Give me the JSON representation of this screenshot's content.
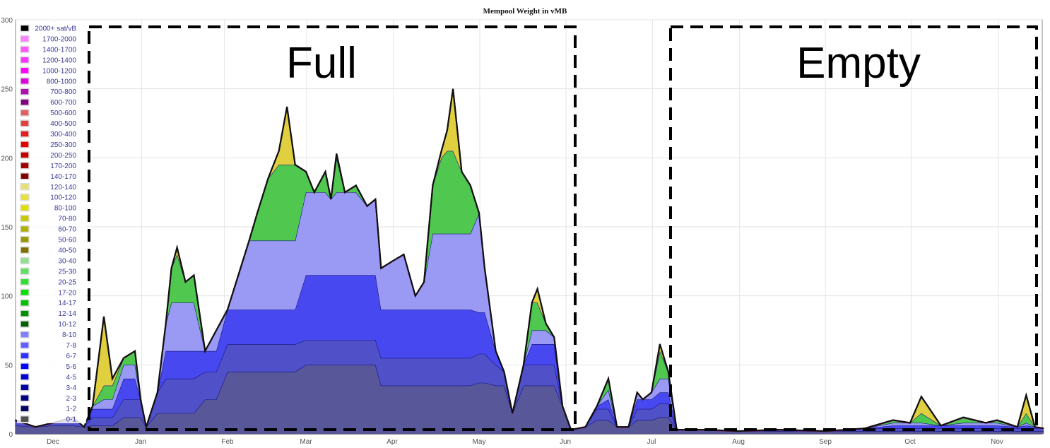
{
  "chart_data": {
    "type": "area",
    "stacked": true,
    "title": "Mempool Weight in vMB",
    "xlabel": "",
    "ylabel": "",
    "ylim": [
      0,
      300
    ],
    "yticks": [
      0,
      50,
      100,
      150,
      200,
      250,
      300
    ],
    "xticks": [
      "Dec",
      "Jan",
      "Feb",
      "Mar",
      "Apr",
      "May",
      "Jun",
      "Jul",
      "Aug",
      "Sep",
      "Oct",
      "Nov"
    ],
    "grid": true,
    "legend_position": "top-left",
    "legend": [
      {
        "label": "2000+ sat/vB",
        "color": "#000000"
      },
      {
        "label": "1700-2000",
        "color": "#ff80ff"
      },
      {
        "label": "1400-1700",
        "color": "#ff55ff"
      },
      {
        "label": "1200-1400",
        "color": "#ff33ff"
      },
      {
        "label": "1000-1200",
        "color": "#ff00ff"
      },
      {
        "label": "800-1000",
        "color": "#dd00dd"
      },
      {
        "label": "700-800",
        "color": "#aa10aa"
      },
      {
        "label": "600-700",
        "color": "#800080"
      },
      {
        "label": "500-600",
        "color": "#e06060"
      },
      {
        "label": "400-500",
        "color": "#e04040"
      },
      {
        "label": "300-400",
        "color": "#e02020"
      },
      {
        "label": "250-300",
        "color": "#e00000"
      },
      {
        "label": "200-250",
        "color": "#c00000"
      },
      {
        "label": "170-200",
        "color": "#a00000"
      },
      {
        "label": "140-170",
        "color": "#800000"
      },
      {
        "label": "120-140",
        "color": "#e8e070"
      },
      {
        "label": "100-120",
        "color": "#e8e040"
      },
      {
        "label": "80-100",
        "color": "#e0e000"
      },
      {
        "label": "70-80",
        "color": "#c8c800"
      },
      {
        "label": "60-70",
        "color": "#b0b000"
      },
      {
        "label": "50-60",
        "color": "#989800"
      },
      {
        "label": "40-50",
        "color": "#807000"
      },
      {
        "label": "30-40",
        "color": "#90e090"
      },
      {
        "label": "25-30",
        "color": "#60e060"
      },
      {
        "label": "20-25",
        "color": "#30e030"
      },
      {
        "label": "17-20",
        "color": "#00e000"
      },
      {
        "label": "14-17",
        "color": "#00c000"
      },
      {
        "label": "12-14",
        "color": "#009000"
      },
      {
        "label": "10-12",
        "color": "#006000"
      },
      {
        "label": "8-10",
        "color": "#8080ff"
      },
      {
        "label": "7-8",
        "color": "#6060ff"
      },
      {
        "label": "6-7",
        "color": "#3030ff"
      },
      {
        "label": "5-6",
        "color": "#0000ff"
      },
      {
        "label": "4-5",
        "color": "#0000d0"
      },
      {
        "label": "3-4",
        "color": "#0000a0"
      },
      {
        "label": "2-3",
        "color": "#000080"
      },
      {
        "label": "1-2",
        "color": "#000060"
      },
      {
        "label": "0-1",
        "color": "#505050"
      }
    ],
    "x": [
      "Nov 18",
      "Nov 25",
      "Dec 1",
      "Dec 8",
      "Dec 12",
      "Dec 15",
      "Dec 19",
      "Dec 22",
      "Dec 26",
      "Dec 30",
      "Jan 1",
      "Jan 3",
      "Jan 7",
      "Jan 10",
      "Jan 12",
      "Jan 14",
      "Jan 17",
      "Jan 20",
      "Jan 24",
      "Jan 28",
      "Feb 1",
      "Feb 5",
      "Feb 9",
      "Feb 12",
      "Feb 16",
      "Feb 20",
      "Feb 23",
      "Feb 26",
      "Mar 1",
      "Mar 4",
      "Mar 8",
      "Mar 10",
      "Mar 12",
      "Mar 15",
      "Mar 19",
      "Mar 23",
      "Mar 26",
      "Mar 28",
      "Apr 1",
      "Apr 5",
      "Apr 9",
      "Apr 12",
      "Apr 15",
      "Apr 18",
      "Apr 20",
      "Apr 22",
      "Apr 25",
      "Apr 28",
      "May 1",
      "May 3",
      "May 7",
      "May 10",
      "May 13",
      "May 17",
      "May 20",
      "May 22",
      "May 25",
      "May 28",
      "May 31",
      "Jun 3",
      "Jun 8",
      "Jun 12",
      "Jun 16",
      "Jun 19",
      "Jun 23",
      "Jun 26",
      "Jun 28",
      "Jul 1",
      "Jul 4",
      "Jul 7",
      "Jul 10",
      "Jul 20",
      "Aug 1",
      "Aug 15",
      "Sep 1",
      "Sep 15",
      "Sep 25",
      "Oct 1",
      "Oct 5",
      "Oct 12",
      "Oct 20",
      "Oct 28",
      "Nov 1",
      "Nov 8",
      "Nov 11",
      "Nov 14",
      "Nov 17"
    ],
    "series": [
      {
        "name": "1-2",
        "color": "#57579a",
        "values": [
          6,
          5,
          6,
          6,
          5,
          6,
          6,
          6,
          12,
          12,
          12,
          5,
          15,
          15,
          15,
          15,
          15,
          15,
          25,
          25,
          45,
          45,
          45,
          45,
          45,
          45,
          45,
          45,
          50,
          50,
          50,
          50,
          50,
          50,
          50,
          50,
          50,
          35,
          35,
          35,
          35,
          35,
          35,
          35,
          35,
          35,
          35,
          35,
          37,
          37,
          35,
          35,
          15,
          35,
          35,
          35,
          35,
          35,
          20,
          3,
          5,
          10,
          10,
          5,
          5,
          10,
          10,
          10,
          12,
          12,
          3,
          3,
          2,
          2,
          2,
          2,
          2,
          2,
          2,
          2,
          2,
          2,
          2,
          2,
          2,
          2,
          2
        ]
      },
      {
        "name": "3-4",
        "color": "#5050c8",
        "values": [
          4,
          0,
          2,
          6,
          0,
          6,
          6,
          6,
          13,
          13,
          13,
          0,
          15,
          25,
          25,
          25,
          25,
          25,
          20,
          20,
          20,
          20,
          20,
          20,
          20,
          20,
          20,
          20,
          18,
          18,
          18,
          18,
          18,
          18,
          18,
          18,
          18,
          20,
          20,
          20,
          20,
          20,
          20,
          20,
          20,
          20,
          20,
          20,
          21,
          21,
          15,
          10,
          0,
          15,
          15,
          15,
          15,
          15,
          0,
          0,
          0,
          8,
          8,
          0,
          0,
          8,
          8,
          8,
          10,
          10,
          0,
          0,
          0,
          1,
          0,
          2,
          2,
          2,
          2,
          2,
          2,
          2,
          2,
          2,
          2,
          2,
          2
        ]
      },
      {
        "name": "5-6",
        "color": "#4848f0",
        "values": [
          0,
          0,
          0,
          0,
          0,
          6,
          6,
          6,
          15,
          15,
          0,
          0,
          0,
          20,
          20,
          20,
          20,
          20,
          15,
          15,
          25,
          25,
          25,
          25,
          25,
          25,
          25,
          25,
          47,
          47,
          47,
          47,
          47,
          47,
          47,
          47,
          47,
          35,
          35,
          35,
          35,
          35,
          35,
          35,
          35,
          35,
          35,
          35,
          30,
          30,
          10,
          0,
          0,
          0,
          15,
          15,
          15,
          15,
          0,
          0,
          0,
          2,
          7,
          0,
          0,
          7,
          7,
          7,
          8,
          8,
          0,
          0,
          0,
          0,
          0,
          0,
          2,
          2,
          2,
          2,
          2,
          2,
          2,
          1,
          2,
          1,
          0
        ]
      },
      {
        "name": "8-10",
        "color": "#9a9af4",
        "values": [
          0,
          0,
          0,
          0,
          0,
          2,
          7,
          7,
          10,
          10,
          0,
          0,
          0,
          20,
          35,
          35,
          35,
          35,
          0,
          15,
          0,
          25,
          50,
          50,
          50,
          50,
          50,
          50,
          60,
          60,
          60,
          55,
          60,
          60,
          60,
          50,
          55,
          30,
          35,
          40,
          10,
          20,
          55,
          55,
          55,
          55,
          55,
          55,
          72,
          32,
          0,
          0,
          0,
          0,
          10,
          10,
          10,
          5,
          0,
          0,
          0,
          0,
          7,
          0,
          0,
          5,
          0,
          5,
          10,
          10,
          0,
          0,
          0,
          0,
          0,
          0,
          2,
          2,
          2,
          0,
          2,
          2,
          2,
          0,
          2,
          0,
          0
        ]
      },
      {
        "name": "14-17",
        "color": "#50c850",
        "values": [
          0,
          0,
          0,
          0,
          0,
          0,
          10,
          10,
          5,
          10,
          0,
          0,
          0,
          0,
          25,
          35,
          15,
          20,
          0,
          0,
          0,
          0,
          0,
          20,
          45,
          55,
          55,
          55,
          15,
          0,
          15,
          0,
          25,
          0,
          5,
          0,
          0,
          0,
          0,
          0,
          0,
          0,
          35,
          55,
          60,
          60,
          45,
          35,
          0,
          0,
          0,
          0,
          0,
          0,
          20,
          20,
          5,
          0,
          0,
          0,
          0,
          0,
          8,
          0,
          0,
          0,
          0,
          0,
          20,
          5,
          0,
          0,
          0,
          0,
          0,
          0,
          2,
          0,
          7,
          0,
          4,
          0,
          2,
          0,
          7,
          0,
          0
        ]
      },
      {
        "name": "80-100",
        "color": "#e0d040",
        "values": [
          0,
          0,
          0,
          0,
          0,
          0,
          50,
          5,
          0,
          0,
          0,
          0,
          0,
          0,
          0,
          5,
          0,
          0,
          0,
          0,
          0,
          0,
          0,
          0,
          0,
          10,
          42,
          0,
          0,
          0,
          0,
          0,
          3,
          0,
          0,
          0,
          0,
          0,
          0,
          0,
          0,
          0,
          0,
          5,
          15,
          45,
          0,
          0,
          0,
          0,
          0,
          0,
          0,
          0,
          0,
          10,
          0,
          0,
          0,
          0,
          0,
          0,
          0,
          0,
          0,
          0,
          0,
          0,
          5,
          0,
          0,
          0,
          0,
          0,
          0,
          0,
          0,
          0,
          12,
          0,
          0,
          0,
          0,
          0,
          13,
          0,
          0
        ]
      }
    ],
    "annotations": [
      {
        "text": "Full",
        "from": "Dec",
        "to": "Jun"
      },
      {
        "text": "Empty",
        "from": "Jul",
        "to": "Nov"
      }
    ]
  }
}
